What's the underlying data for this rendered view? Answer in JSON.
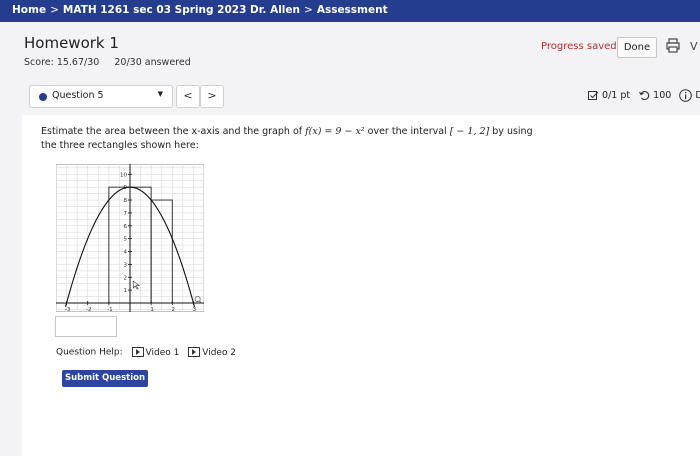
{
  "breadcrumb": {
    "home": "Home",
    "course": "MATH 1261 sec 03 Spring 2023 Dr. Allen",
    "current": "Assessment",
    "separator": ">"
  },
  "homework": {
    "title": "Homework 1",
    "score_label": "Score: 15.67/30",
    "answered": "20/30 answered"
  },
  "status": {
    "progress": "Progress saved",
    "done_label": "Done",
    "cut_text": "V"
  },
  "question_nav": {
    "selected": "Question 5",
    "prev": "<",
    "next": ">"
  },
  "question_meta": {
    "points": "0/1 pt",
    "attempts": "100",
    "cut_text": "D"
  },
  "question": {
    "text_before": "Estimate the area between the x-axis and the graph of ",
    "func": "f(x) = 9 − x²",
    "text_mid": " over the interval ",
    "interval": "[ − 1, 2]",
    "text_after": " by using the three rectangles shown here:",
    "answer_value": ""
  },
  "help": {
    "label": "Question Help:",
    "video1": "Video 1",
    "video2": "Video 2"
  },
  "submit_label": "Submit Question",
  "chart_data": {
    "type": "line",
    "function": "9 - x^2",
    "x_ticks": [
      "-3",
      "-2",
      "-1",
      "1",
      "2",
      "3"
    ],
    "y_ticks": [
      "1",
      "2",
      "3",
      "4",
      "5",
      "6",
      "7",
      "8",
      "9",
      "10"
    ],
    "rectangles": [
      {
        "x_left": -1,
        "x_right": 0,
        "height": 9
      },
      {
        "x_left": 0,
        "x_right": 1,
        "height": 9
      },
      {
        "x_left": 1,
        "x_right": 2,
        "height": 8
      }
    ],
    "xlim": [
      -3.5,
      3.5
    ],
    "ylim": [
      -0.7,
      10.8
    ],
    "grid": true
  },
  "colors": {
    "topbar": "#243d8f",
    "progress": "#b0302e",
    "submit": "#2d44a0"
  }
}
